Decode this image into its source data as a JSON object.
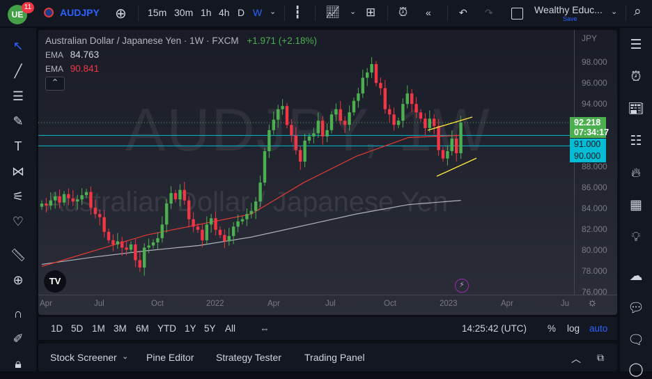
{
  "toolbar": {
    "notifications": "11",
    "symbol": "AUDJPY",
    "intervals": [
      "15m",
      "30m",
      "1h",
      "4h",
      "D",
      "W"
    ],
    "active_interval": "W",
    "layout_name": "Wealthy Educ...",
    "save": "Save"
  },
  "legend": {
    "title": "Australian Dollar / Japanese Yen · 1W · FXCM",
    "change": "+1.971 (+2.18%)",
    "ema1_label": "EMA",
    "ema1_value": "84.763",
    "ema2_label": "EMA",
    "ema2_value": "90.841"
  },
  "watermark": {
    "symbol": "AUDJPY, 1W",
    "name": "Australian Dollar / Japanese Yen"
  },
  "price_axis": {
    "currency": "JPY",
    "ticks": [
      "98.000",
      "96.000",
      "94.000",
      "88.000",
      "86.000",
      "84.000",
      "82.000",
      "80.000",
      "78.000",
      "76.000"
    ],
    "last_price": "92.218",
    "countdown": "07:34:17",
    "level1": "91.000",
    "level2": "90.000"
  },
  "time_axis": [
    "Apr",
    "Jul",
    "Oct",
    "2022",
    "Apr",
    "Jul",
    "Oct",
    "2023",
    "Apr",
    "Ju"
  ],
  "timeframes": [
    "1D",
    "5D",
    "1M",
    "3M",
    "6M",
    "YTD",
    "1Y",
    "5Y",
    "All"
  ],
  "footer": {
    "clock": "14:25:42 (UTC)",
    "percent": "%",
    "log": "log",
    "auto": "auto"
  },
  "bottom_tabs": [
    "Stock Screener",
    "Pine Editor",
    "Strategy Tester",
    "Trading Panel"
  ],
  "colors": {
    "up": "#4caf50",
    "down": "#f23645",
    "ema_fast": "#e53935",
    "ema_slow": "#b2b5be",
    "level": "#00bcd4",
    "trend": "#ffeb3b"
  },
  "chart_data": {
    "type": "candlestick",
    "interval": "1W",
    "ylim": [
      76,
      98
    ],
    "closes": [
      84.5,
      84.3,
      84.8,
      85.2,
      84.6,
      85.4,
      85.0,
      84.7,
      84.9,
      85.3,
      85.6,
      84.1,
      83.5,
      83.2,
      81.8,
      81.0,
      80.6,
      80.9,
      80.3,
      80.1,
      80.6,
      79.1,
      78.4,
      80.3,
      80.5,
      80.8,
      81.2,
      82.5,
      84.5,
      85.5,
      84.9,
      85.8,
      84.8,
      83.0,
      82.3,
      82.0,
      81.0,
      82.5,
      83.1,
      82.0,
      81.5,
      80.9,
      81.4,
      82.3,
      82.8,
      83.0,
      83.5,
      83.8,
      84.7,
      86.5,
      89.5,
      91.5,
      92.5,
      93.5,
      93.8,
      92.0,
      91.0,
      89.6,
      88.5,
      90.5,
      90.9,
      91.2,
      92.4,
      90.9,
      91.5,
      93.0,
      93.5,
      92.4,
      92.0,
      93.2,
      94.3,
      95.0,
      96.5,
      97.0,
      97.8,
      96.0,
      95.5,
      93.5,
      93.0,
      92.0,
      92.4,
      94.0,
      95.0,
      94.0,
      93.2,
      92.6,
      91.7,
      92.6,
      91.9,
      89.6,
      88.8,
      89.5,
      90.7,
      89.3,
      92.218
    ],
    "ema_fast": [
      78.5,
      80.0,
      81.5,
      82.5,
      83.5,
      86.5,
      89.0,
      90.8,
      91.0
    ],
    "ema_slow": [
      78.7,
      79.4,
      80.0,
      80.5,
      81.3,
      82.4,
      83.5,
      84.4,
      84.8
    ],
    "levels": [
      91,
      90
    ]
  }
}
